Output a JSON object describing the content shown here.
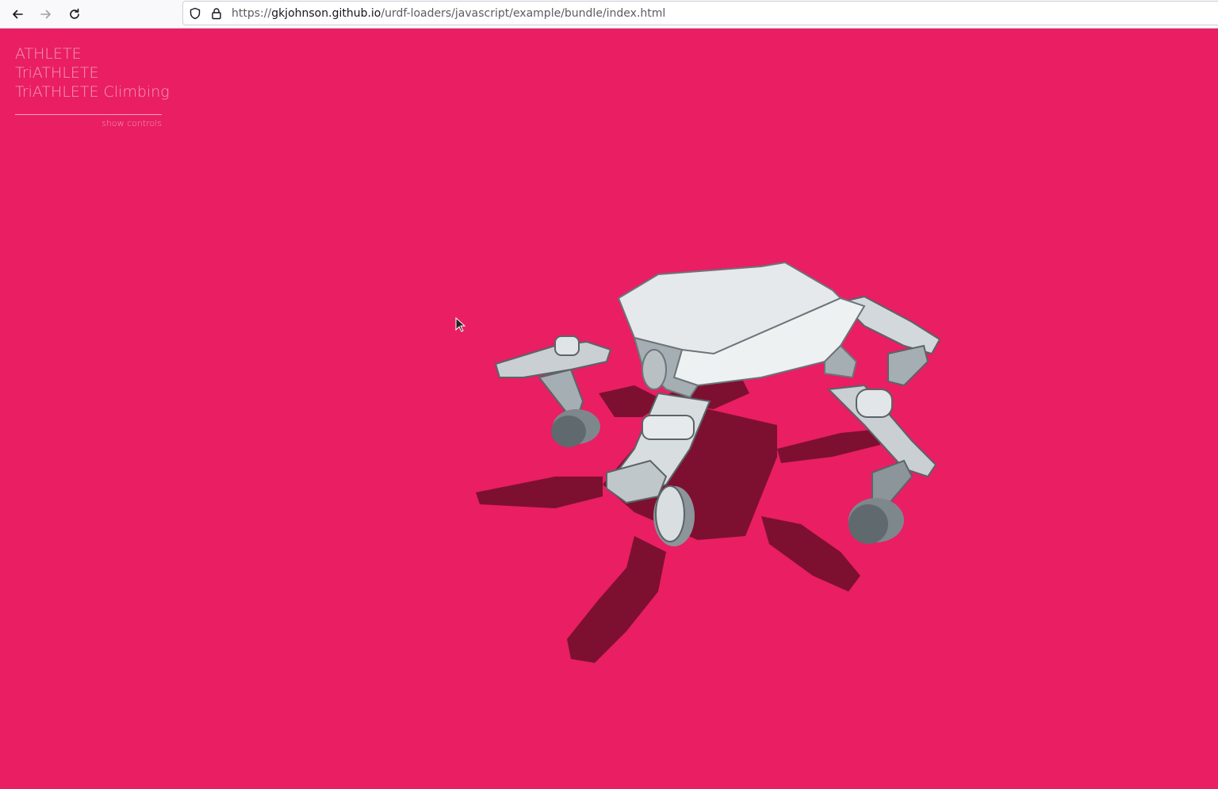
{
  "browser": {
    "url_scheme": "https://",
    "url_domain": "gkjohnson.github.io",
    "url_path": "/urdf-loaders/javascript/example/bundle/index.html",
    "icons": {
      "back": "back-arrow-icon",
      "forward": "forward-arrow-icon",
      "reload": "reload-icon",
      "tracking": "shield-icon",
      "security": "lock-icon"
    }
  },
  "app": {
    "background_color": "#e91e63",
    "robots": [
      {
        "label": "ATHLETE"
      },
      {
        "label": "TriATHLETE"
      },
      {
        "label": "TriATHLETE Climbing"
      }
    ],
    "show_controls_label": "show controls",
    "scene_description_icon": "robot-3d-model"
  }
}
